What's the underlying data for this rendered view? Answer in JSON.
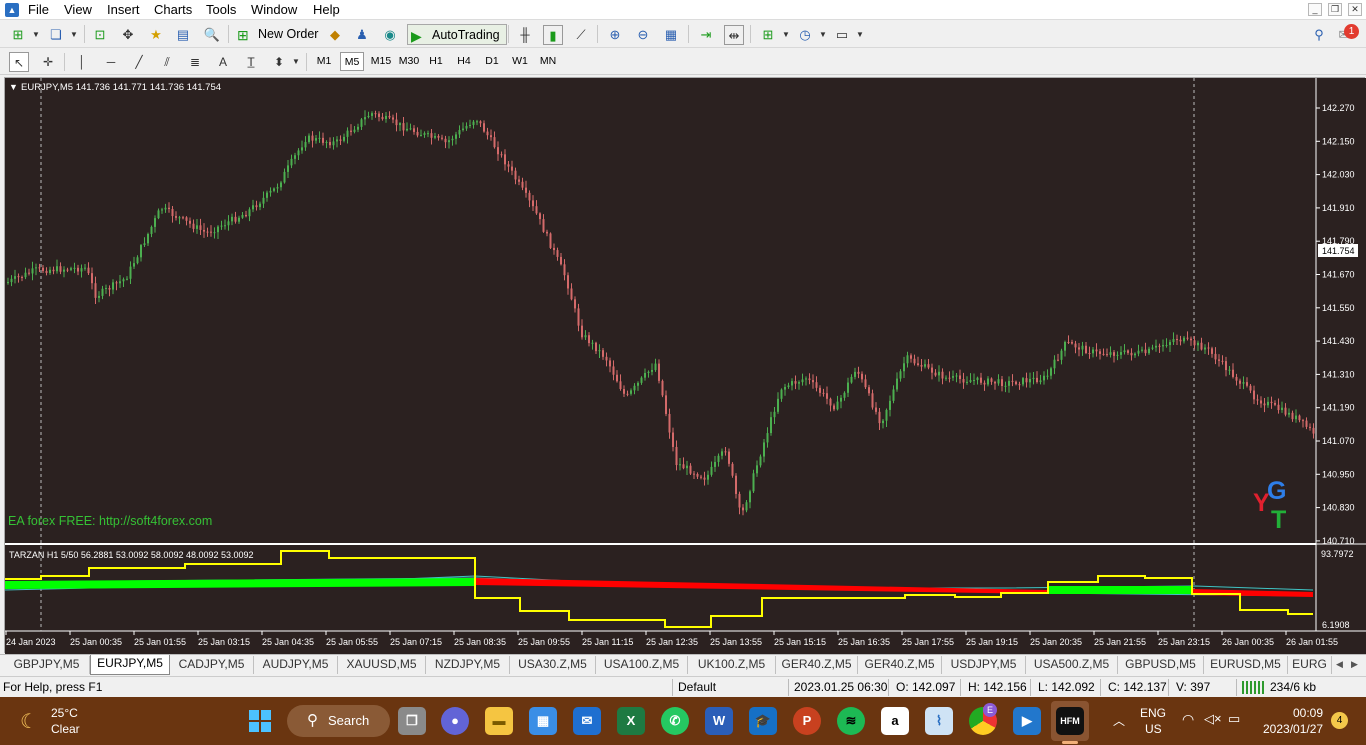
{
  "menubar": {
    "items": [
      "File",
      "View",
      "Insert",
      "Charts",
      "Tools",
      "Window",
      "Help"
    ]
  },
  "toolbar": {
    "new_order": "New Order",
    "autotrading": "AutoTrading",
    "timeframes": [
      "M1",
      "M5",
      "M15",
      "M30",
      "H1",
      "H4",
      "D1",
      "W1",
      "MN"
    ],
    "active_timeframe": "M5"
  },
  "chart": {
    "header": "EURJPY,M5  141.736 141.771 141.736 141.754",
    "watermark": "EA forex FREE: http://soft4forex.com",
    "logo_letters": [
      "Y",
      "G",
      "T"
    ],
    "price_labels": [
      "142.270",
      "142.150",
      "142.030",
      "141.910",
      "141.790",
      "141.670",
      "141.550",
      "141.430",
      "141.310",
      "141.190",
      "141.070",
      "140.950",
      "140.830",
      "140.710"
    ],
    "current_price": "141.754",
    "indicator_header": "TARZAN H1 5/50 56.2881 53.0092 58.0092 48.0092 53.0092",
    "indicator_scale": [
      "93.7972",
      "6.1908"
    ],
    "time_labels": [
      "24 Jan 2023",
      "25 Jan 00:35",
      "25 Jan 01:55",
      "25 Jan 03:15",
      "25 Jan 04:35",
      "25 Jan 05:55",
      "25 Jan 07:15",
      "25 Jan 08:35",
      "25 Jan 09:55",
      "25 Jan 11:15",
      "25 Jan 12:35",
      "25 Jan 13:55",
      "25 Jan 15:15",
      "25 Jan 16:35",
      "25 Jan 17:55",
      "25 Jan 19:15",
      "25 Jan 20:35",
      "25 Jan 21:55",
      "25 Jan 23:15",
      "26 Jan 00:35",
      "26 Jan 01:55"
    ],
    "colors": {
      "bg": "#2b2120",
      "bull": "#4caf50",
      "bear": "#d46a6a",
      "axis": "#ffffff",
      "watermark": "#35c135",
      "ind_green": "#00ff00",
      "ind_red": "#ff0000",
      "ind_yellow": "#ffff00",
      "ind_cyan": "#40c4c4"
    }
  },
  "symbol_tabs": [
    "GBPJPY,M5",
    "EURJPY,M5",
    "CADJPY,M5",
    "AUDJPY,M5",
    "XAUUSD,M5",
    "NZDJPY,M5",
    "USA30.Z,M5",
    "USA100.Z,M5",
    "UK100.Z,M5",
    "GER40.Z,M5",
    "GER40.Z,M5",
    "USDJPY,M5",
    "USA500.Z,M5",
    "GBPUSD,M5",
    "EURUSD,M5",
    "EURG"
  ],
  "active_symbol_tab": "EURJPY,M5",
  "status": {
    "help": "For Help, press F1",
    "profile": "Default",
    "datetime": "2023.01.25 06:30",
    "open": "O: 142.097",
    "high": "H: 142.156",
    "low": "L: 142.092",
    "close": "C: 142.137",
    "volume": "V: 397",
    "traffic": "234/6 kb"
  },
  "taskbar": {
    "weather_temp": "25°C",
    "weather_desc": "Clear",
    "search": "Search",
    "lang1": "ENG",
    "lang2": "US",
    "time": "00:09",
    "date": "2023/01/27",
    "notif_count": "4",
    "msg_count": "1",
    "chrome_badge": "E",
    "app_label": "HFM"
  }
}
